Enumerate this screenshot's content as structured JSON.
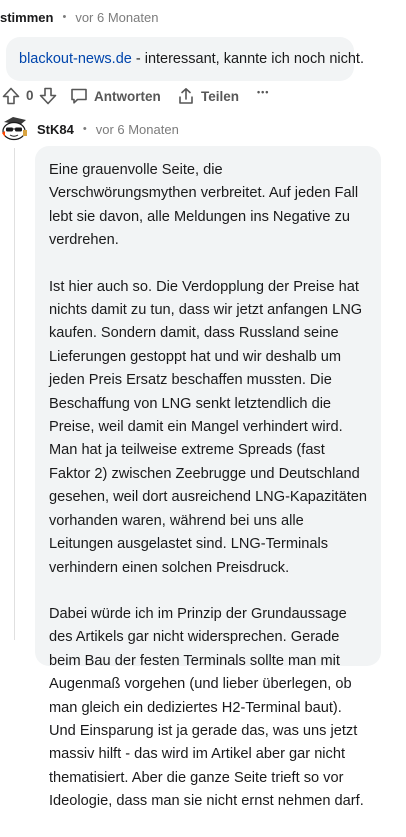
{
  "comment1": {
    "author": "stimmen",
    "separator": "•",
    "time": "vor 6 Monaten",
    "link_text": "blackout-news.de",
    "body_rest": " - interessant, kannte ich noch nicht."
  },
  "actions": {
    "score": "0",
    "reply_label": "Antworten",
    "share_label": "Teilen",
    "more_label": "•••"
  },
  "comment2": {
    "author": "StK84",
    "separator": "•",
    "time": "vor 6 Monaten",
    "paragraphs": [
      "Eine grauenvolle Seite, die Verschwörungsmythen verbreitet. Auf jeden Fall lebt sie davon, alle Meldungen ins Negative zu verdrehen.",
      "Ist hier auch so. Die Verdopplung der Preise hat nichts damit zu tun, dass wir jetzt anfangen LNG kaufen. Sondern damit, dass Russland seine Lieferungen gestoppt hat und wir deshalb um jeden Preis Ersatz beschaffen mussten. Die Beschaffung von LNG senkt letztendlich die Preise, weil damit ein Mangel verhindert wird. Man hat ja teilweise extreme Spreads (fast Faktor 2) zwischen Zeebrugge und Deutschland gesehen, weil dort ausreichend LNG-Kapazitäten vorhanden waren, während bei uns alle Leitungen ausgelastet sind. LNG-Terminals verhindern einen solchen Preisdruck.",
      "Dabei würde ich im Prinzip der Grundaussage des Artikels gar nicht widersprechen. Gerade beim Bau der festen Terminals sollte man mit Augenmaß vorgehen (und lieber überlegen, ob man gleich ein dediziertes H2-Terminal baut). Und Einsparung ist ja gerade das, was uns jetzt massiv hilft - das wird im Artikel aber gar nicht thematisiert. Aber die ganze Seite trieft so vor Ideologie, dass man sie nicht ernst nehmen darf."
    ]
  }
}
